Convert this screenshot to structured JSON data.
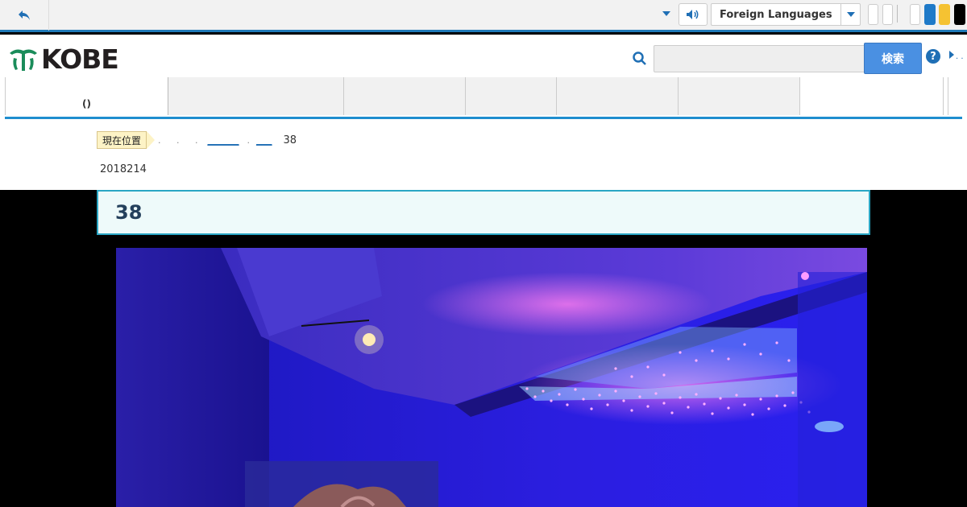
{
  "topbar": {
    "language_select_value": "Foreign Languages",
    "color_swatches": [
      "#1f7ac8",
      "#f5c232",
      "#000000"
    ]
  },
  "header": {
    "logo_text": "KOBE",
    "search": {
      "placeholder": "",
      "button_label": "検索"
    },
    "help_icon": "?",
    "more_dots": ". ."
  },
  "nav": {
    "items": [
      {
        "label": "()"
      },
      {
        "label": ""
      },
      {
        "label": ""
      },
      {
        "label": ""
      },
      {
        "label": ""
      },
      {
        "label": ""
      },
      {
        "label": ""
      }
    ]
  },
  "breadcrumb": {
    "here_label": "現在位置",
    "dots": ". . .",
    "link1": "______",
    "sep": ".",
    "link2": "___",
    "current": "38"
  },
  "page": {
    "update_date": "2018214",
    "title": "38"
  },
  "colors": {
    "accent": "#1f7ab8",
    "title_border": "#2aa6c4",
    "title_bg": "#eefafa"
  }
}
